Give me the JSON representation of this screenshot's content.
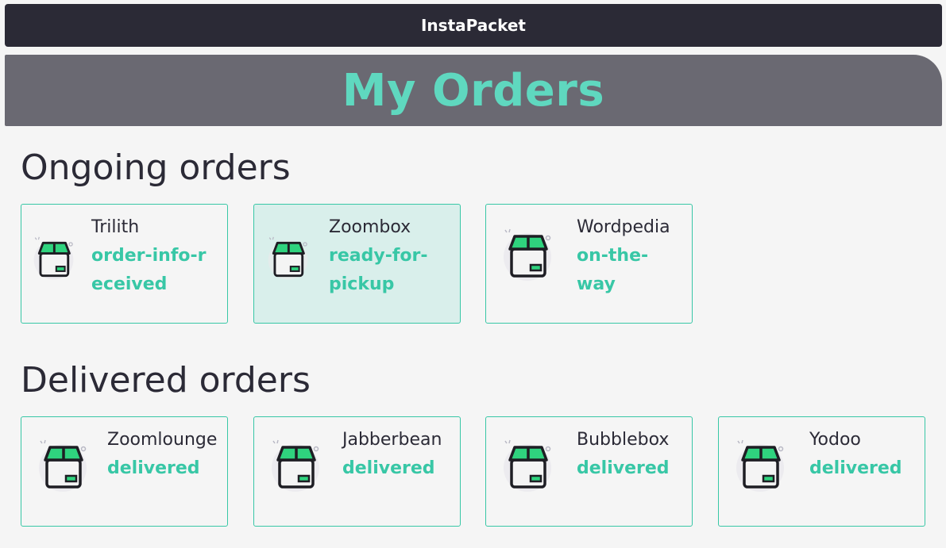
{
  "app": {
    "title": "InstaPacket"
  },
  "header": {
    "title": "My Orders"
  },
  "colors": {
    "accent": "#38c7a6",
    "topbar": "#2b2a36",
    "banner": "#6a6972",
    "selected_card": "#d9efeb"
  },
  "ongoing": {
    "title": "Ongoing orders",
    "orders": [
      {
        "name": "Trilith",
        "status": "order-info-received",
        "icon": "package-box-icon"
      },
      {
        "name": "Zoombox",
        "status": "ready-for-pickup",
        "icon": "package-box-icon"
      },
      {
        "name": "Wordpedia",
        "status": "on-the-way",
        "icon": "package-box-icon"
      }
    ]
  },
  "delivered": {
    "title": "Delivered orders",
    "orders": [
      {
        "name": "Zoomlounge",
        "status": "delivered",
        "icon": "package-box-icon"
      },
      {
        "name": "Jabberbean",
        "status": "delivered",
        "icon": "package-box-icon"
      },
      {
        "name": "Bubblebox",
        "status": "delivered",
        "icon": "package-box-icon"
      },
      {
        "name": "Yodoo",
        "status": "delivered",
        "icon": "package-box-icon"
      }
    ]
  }
}
